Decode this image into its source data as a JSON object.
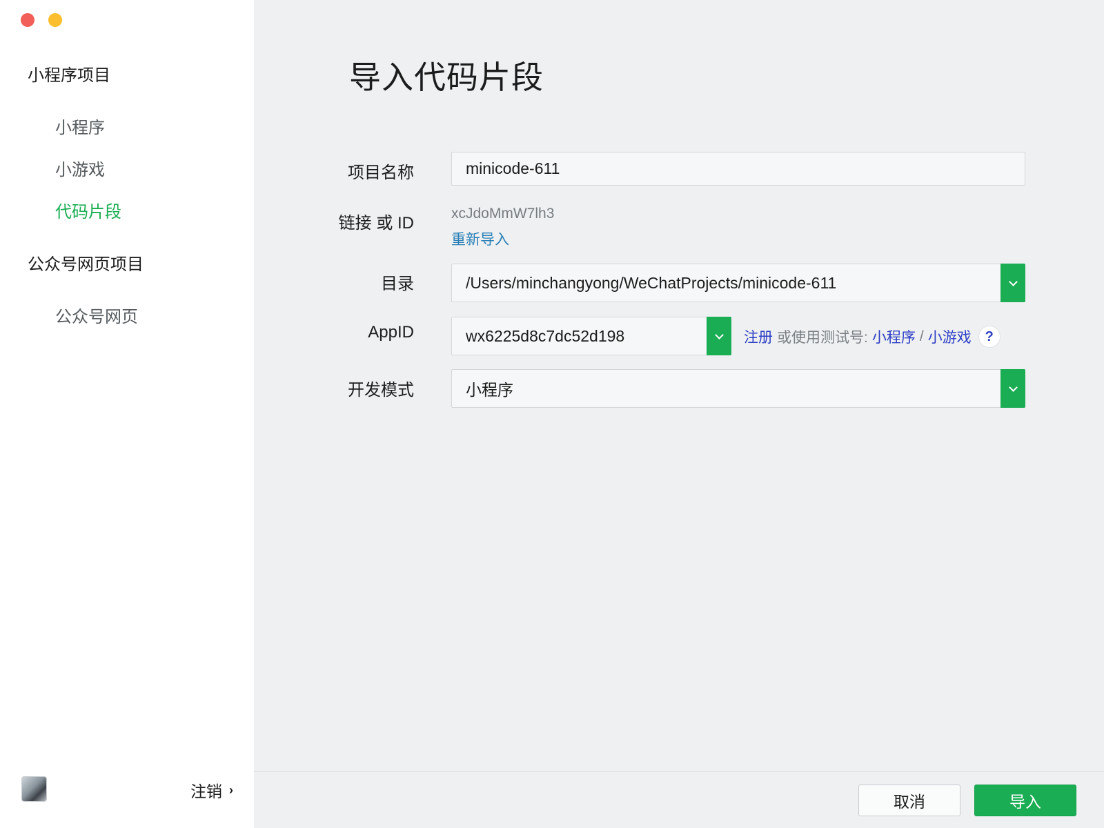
{
  "sidebar": {
    "groups": [
      {
        "title": "小程序项目",
        "items": [
          "小程序",
          "小游戏",
          "代码片段"
        ]
      },
      {
        "title": "公众号网页项目",
        "items": [
          "公众号网页"
        ]
      }
    ],
    "active_item": "代码片段",
    "logout_label": "注销"
  },
  "page": {
    "title": "导入代码片段"
  },
  "form": {
    "project_name": {
      "label": "项目名称",
      "value": "minicode-611"
    },
    "link_id": {
      "label": "链接 或 ID",
      "value": "xcJdoMmW7lh3",
      "reimport_label": "重新导入"
    },
    "directory": {
      "label": "目录",
      "value": "/Users/minchangyong/WeChatProjects/minicode-611"
    },
    "appid": {
      "label": "AppID",
      "value": "wx6225d8c7dc52d198",
      "register_label": "注册",
      "or_test_label": "或使用测试号:",
      "miniprogram_link": "小程序",
      "separator": "/",
      "minigame_link": "小游戏",
      "help_label": "?"
    },
    "dev_mode": {
      "label": "开发模式",
      "value": "小程序"
    }
  },
  "footer": {
    "cancel_label": "取消",
    "import_label": "导入"
  },
  "colors": {
    "accent": "#1aad53",
    "link": "#2e3fc4",
    "close": "#f25f58",
    "minimize": "#fbbe2e"
  }
}
